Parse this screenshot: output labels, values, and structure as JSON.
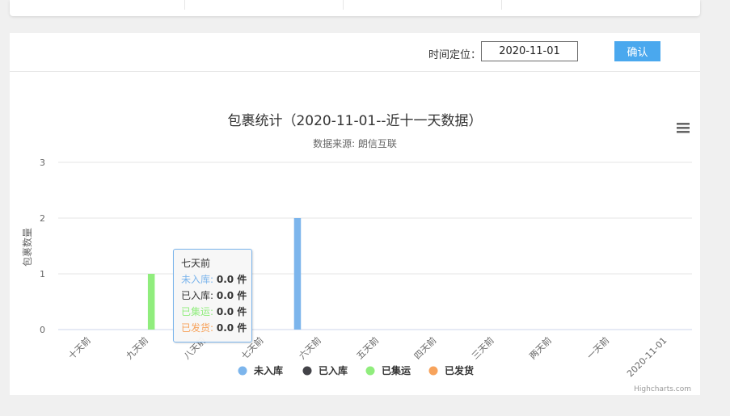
{
  "filter": {
    "label": "时间定位：",
    "date_value": "2020-11-01",
    "confirm_label": "确认"
  },
  "colors": {
    "series": [
      "#7cb5ec",
      "#434348",
      "#90ed7d",
      "#f7a35c"
    ]
  },
  "chart_data": {
    "type": "bar",
    "title": "包裹统计（2020-11-01--近十一天数据）",
    "subtitle": "数据来源: 朗信互联",
    "ylabel": "包裹数量",
    "xlabel": "",
    "ylim": [
      0,
      3
    ],
    "yticks": [
      "0",
      "1",
      "2",
      "3"
    ],
    "categories": [
      "十天前",
      "九天前",
      "八天前",
      "七天前",
      "六天前",
      "五天前",
      "四天前",
      "三天前",
      "两天前",
      "一天前",
      "2020-11-01"
    ],
    "series": [
      {
        "name": "未入库",
        "values": [
          0,
          0,
          0,
          0,
          2,
          0,
          0,
          0,
          0,
          0,
          0
        ]
      },
      {
        "name": "已入库",
        "values": [
          0,
          0,
          0,
          0,
          0,
          0,
          0,
          0,
          0,
          0,
          0
        ]
      },
      {
        "name": "已集运",
        "values": [
          0,
          1,
          0,
          0,
          0,
          0,
          0,
          0,
          0,
          0,
          0
        ]
      },
      {
        "name": "已发货",
        "values": [
          0,
          0,
          0,
          0,
          0,
          0,
          0,
          0,
          0,
          0,
          0
        ]
      }
    ],
    "grid": true,
    "legend_position": "bottom-center",
    "credits": "Highcharts.com"
  },
  "tooltip": {
    "header": "七天前",
    "rows": [
      {
        "name": "未入库:",
        "value": "0.0 件"
      },
      {
        "name": "已入库:",
        "value": "0.0 件"
      },
      {
        "name": "已集运:",
        "value": "0.0 件"
      },
      {
        "name": "已发货:",
        "value": "0.0 件"
      }
    ]
  }
}
